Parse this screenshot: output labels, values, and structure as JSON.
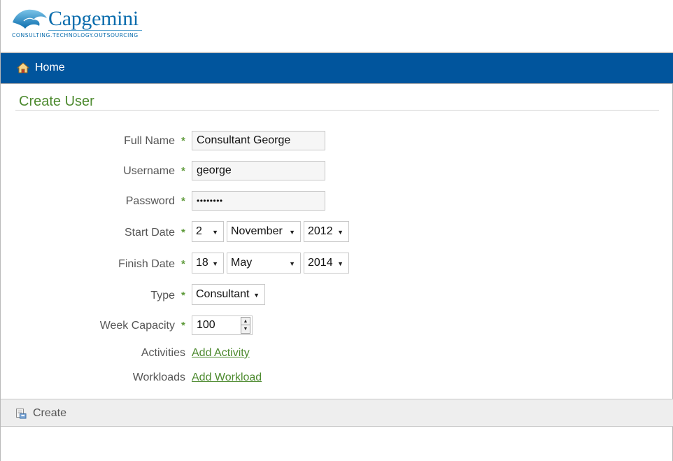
{
  "header": {
    "logo_name": "Capgemini",
    "logo_tagline": "CONSULTING.TECHNOLOGY.OUTSOURCING"
  },
  "nav": {
    "home_label": "Home",
    "bar_color": "#01559d"
  },
  "page": {
    "title": "Create User",
    "accent_color": "#4d8a2f"
  },
  "form": {
    "required_marker": "*",
    "full_name": {
      "label": "Full Name",
      "value": "Consultant George"
    },
    "username": {
      "label": "Username",
      "value": "george"
    },
    "password": {
      "label": "Password",
      "value": "••••••••"
    },
    "start_date": {
      "label": "Start Date",
      "day": "2",
      "month": "November",
      "year": "2012"
    },
    "finish_date": {
      "label": "Finish Date",
      "day": "18",
      "month": "May",
      "year": "2014"
    },
    "type": {
      "label": "Type",
      "value": "Consultant"
    },
    "week_capacity": {
      "label": "Week Capacity",
      "value": "100"
    },
    "activities": {
      "label": "Activities",
      "link": "Add Activity"
    },
    "workloads": {
      "label": "Workloads",
      "link": "Add Workload"
    }
  },
  "actions": {
    "create_label": "Create"
  },
  "icons": [
    "home-icon",
    "create-icon",
    "dropdown-arrow-icon",
    "spinner-up-icon",
    "spinner-down-icon",
    "capgemini-spade-logo"
  ]
}
